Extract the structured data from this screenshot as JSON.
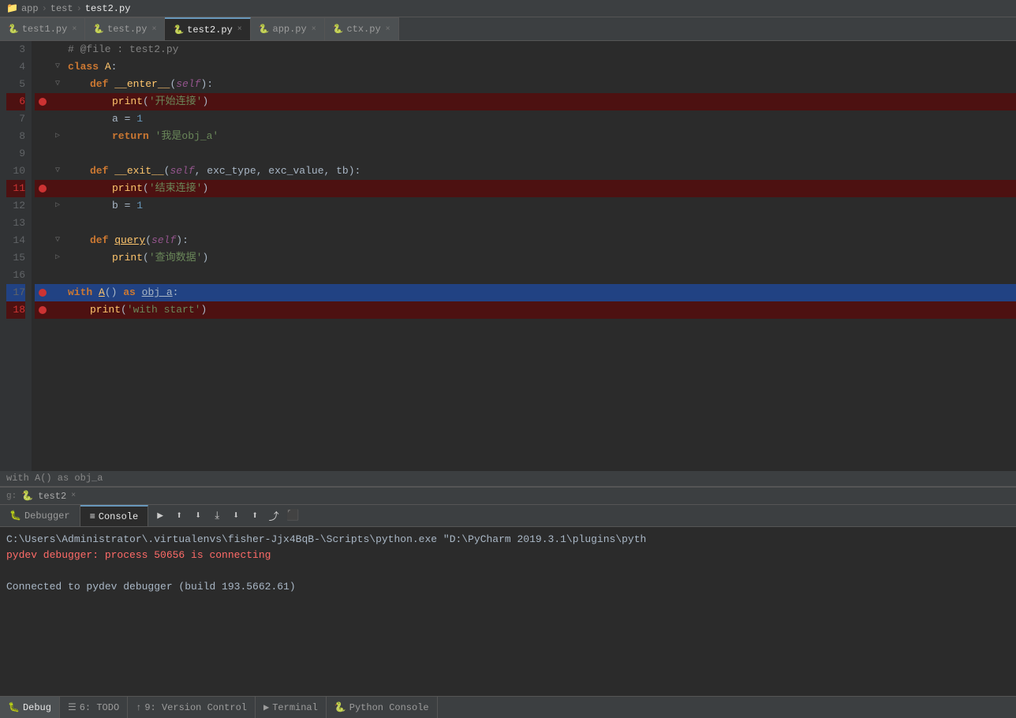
{
  "breadcrumb": {
    "items": [
      "app",
      "test",
      "test2.py"
    ]
  },
  "tabs": [
    {
      "label": "test1.py",
      "icon": "🐍",
      "active": false
    },
    {
      "label": "test.py",
      "icon": "🐍",
      "active": false
    },
    {
      "label": "test2.py",
      "icon": "🐍",
      "active": true
    },
    {
      "label": "app.py",
      "icon": "🐍",
      "active": false
    },
    {
      "label": "ctx.py",
      "icon": "🐍",
      "active": false
    }
  ],
  "code": {
    "lines": [
      {
        "num": 3,
        "text": "# @file    : test2.py",
        "type": "comment",
        "bp": false,
        "fold": false,
        "highlight": "none"
      },
      {
        "num": 4,
        "text": "class A:",
        "type": "class",
        "bp": false,
        "fold": true,
        "highlight": "none"
      },
      {
        "num": 5,
        "text": "    def __enter__(self):",
        "type": "def",
        "bp": false,
        "fold": true,
        "highlight": "none"
      },
      {
        "num": 6,
        "text": "        print('开始连接')",
        "type": "code",
        "bp": true,
        "fold": false,
        "highlight": "breakpoint"
      },
      {
        "num": 7,
        "text": "        a = 1",
        "type": "code",
        "bp": false,
        "fold": false,
        "highlight": "none"
      },
      {
        "num": 8,
        "text": "        return '我是obj_a'",
        "type": "code",
        "bp": false,
        "fold": true,
        "highlight": "none"
      },
      {
        "num": 9,
        "text": "",
        "type": "empty",
        "bp": false,
        "fold": false,
        "highlight": "none"
      },
      {
        "num": 10,
        "text": "    def __exit__(self, exc_type, exc_value, tb):",
        "type": "def",
        "bp": false,
        "fold": true,
        "highlight": "none"
      },
      {
        "num": 11,
        "text": "        print('结束连接')",
        "type": "code",
        "bp": true,
        "fold": false,
        "highlight": "breakpoint"
      },
      {
        "num": 12,
        "text": "        b = 1",
        "type": "code",
        "bp": false,
        "fold": true,
        "highlight": "none"
      },
      {
        "num": 13,
        "text": "",
        "type": "empty",
        "bp": false,
        "fold": false,
        "highlight": "none"
      },
      {
        "num": 14,
        "text": "    def query(self):",
        "type": "def",
        "bp": false,
        "fold": true,
        "highlight": "none"
      },
      {
        "num": 15,
        "text": "        print('查询数据')",
        "type": "code",
        "bp": false,
        "fold": true,
        "highlight": "none"
      },
      {
        "num": 16,
        "text": "",
        "type": "empty",
        "bp": false,
        "fold": false,
        "highlight": "none"
      },
      {
        "num": 17,
        "text": "with A() as obj_a:",
        "type": "code",
        "bp": true,
        "fold": false,
        "highlight": "current"
      },
      {
        "num": 18,
        "text": "    print('with start')",
        "type": "code",
        "bp": true,
        "fold": false,
        "highlight": "breakpoint"
      }
    ],
    "hint_line": "with A() as obj_a"
  },
  "debug_panel": {
    "tabs": [
      {
        "label": "Debugger",
        "icon": "🐛",
        "active": false
      },
      {
        "label": "Console",
        "icon": "≡",
        "active": true
      }
    ],
    "toolbar_icons": [
      "⬆",
      "⬇",
      "⤓",
      "⬇",
      "⬆",
      "⤴",
      "⬛"
    ],
    "debug_name": "test2",
    "console_lines": [
      {
        "text": "C:\\Users\\Administrator\\.virtualenvs\\fisher-Jjx4BqB-\\Scripts\\python.exe \"D:\\PyCharm 2019.3.1\\plugins\\pyth",
        "style": "gray"
      },
      {
        "text": "pydev debugger: process 50656 is connecting",
        "style": "red"
      },
      {
        "text": "",
        "style": "gray"
      },
      {
        "text": "Connected to pydev debugger (build 193.5662.61)",
        "style": "gray"
      }
    ]
  },
  "bottom_bar": {
    "items": [
      {
        "label": "Debug",
        "icon": "🐛",
        "active": true
      },
      {
        "label": "6: TODO",
        "icon": "☰"
      },
      {
        "label": "9: Version Control",
        "icon": "↑"
      },
      {
        "label": "Terminal",
        "icon": "▶"
      },
      {
        "label": "Python Console",
        "icon": "🐍"
      }
    ]
  },
  "side_buttons": [
    "▶",
    "▶",
    "≡",
    "⊞"
  ],
  "colors": {
    "bg": "#2b2b2b",
    "panel_bg": "#3c3f41",
    "accent": "#6897bb",
    "breakpoint": "#cc3333",
    "current_line": "#214283",
    "breakpoint_line": "#4d1111"
  }
}
